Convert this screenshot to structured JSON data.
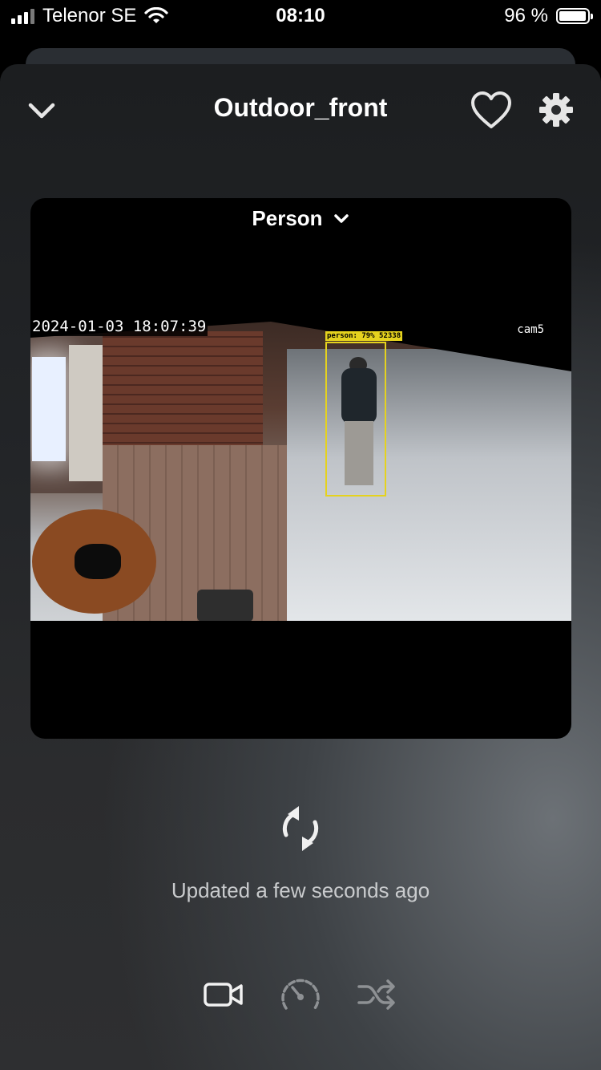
{
  "status_bar": {
    "carrier": "Telenor SE",
    "time": "08:10",
    "battery_text": "96 %",
    "battery_level": 0.96,
    "signal_bars": 3
  },
  "header": {
    "title": "Outdoor_front",
    "back_icon": "chevron-down-icon",
    "favorite_icon": "heart-icon",
    "settings_icon": "gear-icon"
  },
  "player": {
    "filter_label": "Person",
    "timestamp": "2024-01-03 18:07:39",
    "camera_label": "cam5",
    "detection_label": "person: 79% 52338"
  },
  "refresh": {
    "icon": "refresh-icon",
    "updated_text": "Updated a few seconds ago"
  },
  "bottom_bar": {
    "items": [
      {
        "icon": "video-camera-icon"
      },
      {
        "icon": "speedometer-icon"
      },
      {
        "icon": "shuffle-icon"
      }
    ]
  },
  "colors": {
    "detection_box": "#e5d21e",
    "text_secondary": "#c9cbcd"
  }
}
